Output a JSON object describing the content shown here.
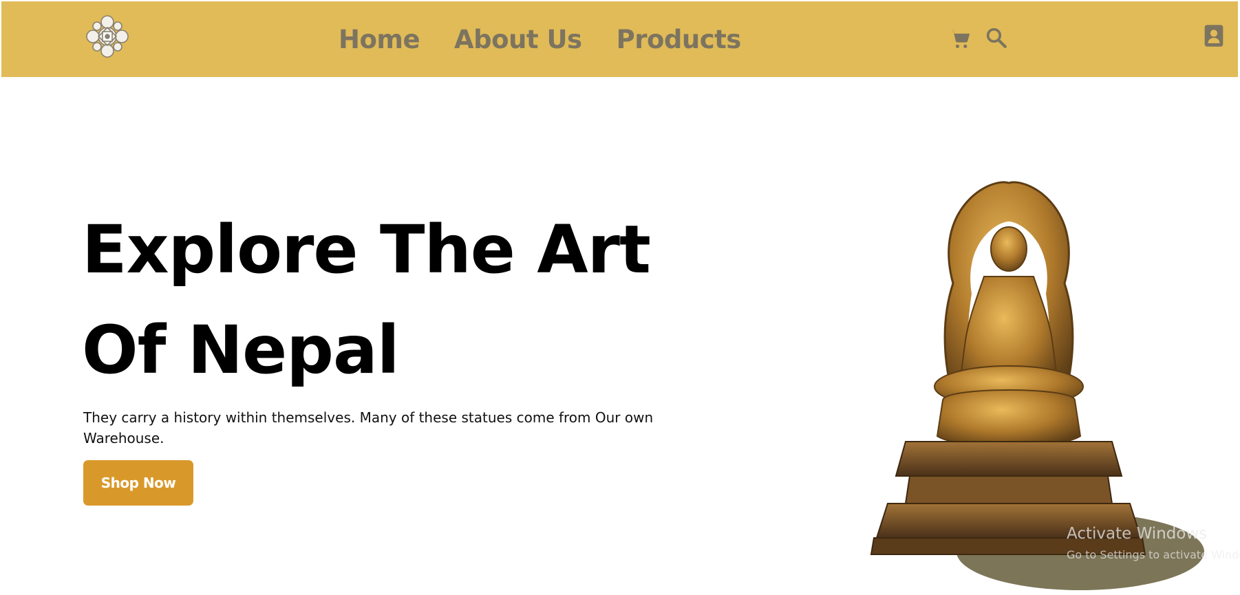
{
  "nav": {
    "links": [
      "Home",
      "About Us",
      "Products"
    ],
    "icons": [
      "cart-icon",
      "search-icon",
      "account-icon"
    ]
  },
  "hero": {
    "title_line1": "Explore The Art",
    "title_line2": "Of Nepal",
    "subtitle": "They carry a history within themselves. Many of these statues come from Our own Warehouse.",
    "cta_label": "Shop Now"
  },
  "watermark": {
    "title": "Activate Windows",
    "subtitle": "Go to Settings to activate Windows."
  },
  "colors": {
    "nav_background": "#e0bb57",
    "nav_text": "#7d7460",
    "cta_background": "#d9992a",
    "cta_text": "#ffffff",
    "hero_text": "#000000"
  }
}
